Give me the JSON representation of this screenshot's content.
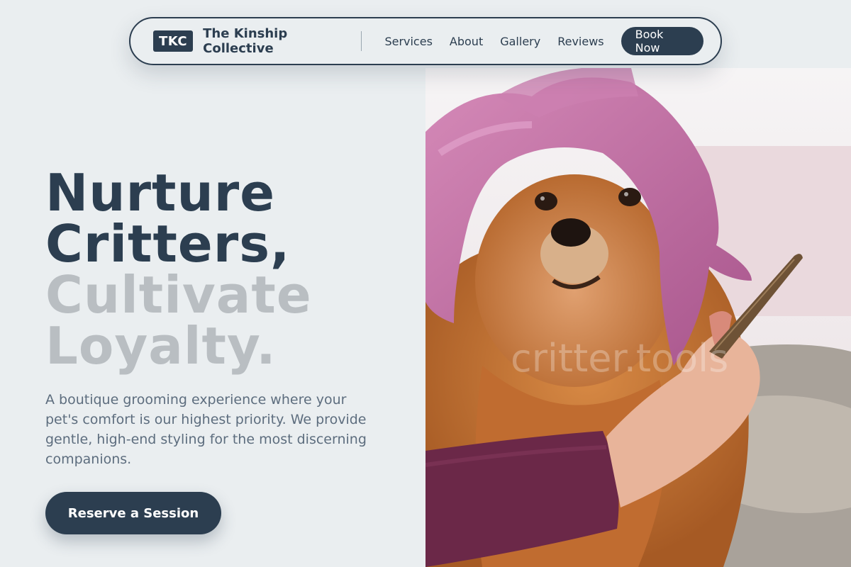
{
  "nav": {
    "logo_badge": "TKC",
    "brand_name": "The Kinship Collective",
    "links": [
      {
        "label": "Services"
      },
      {
        "label": "About"
      },
      {
        "label": "Gallery"
      },
      {
        "label": "Reviews"
      }
    ],
    "cta_label": "Book Now"
  },
  "hero": {
    "headline_dark": [
      "Nurture",
      "Critters,"
    ],
    "headline_muted": [
      "Cultivate",
      "Loyalty."
    ],
    "tagline": "A boutique grooming experience where your pet's comfort is our highest priority. We provide gentle, high-end styling for the most discerning companions.",
    "cta_label": "Reserve a Session"
  },
  "photo": {
    "watermark": "critter.tools"
  },
  "colors": {
    "primary": "#2c3e50",
    "background": "#eaeef0",
    "muted_heading": "#b9bec2",
    "body_text": "#5d6d7e",
    "towel": "#c270a6",
    "fur": "#c9783b"
  }
}
